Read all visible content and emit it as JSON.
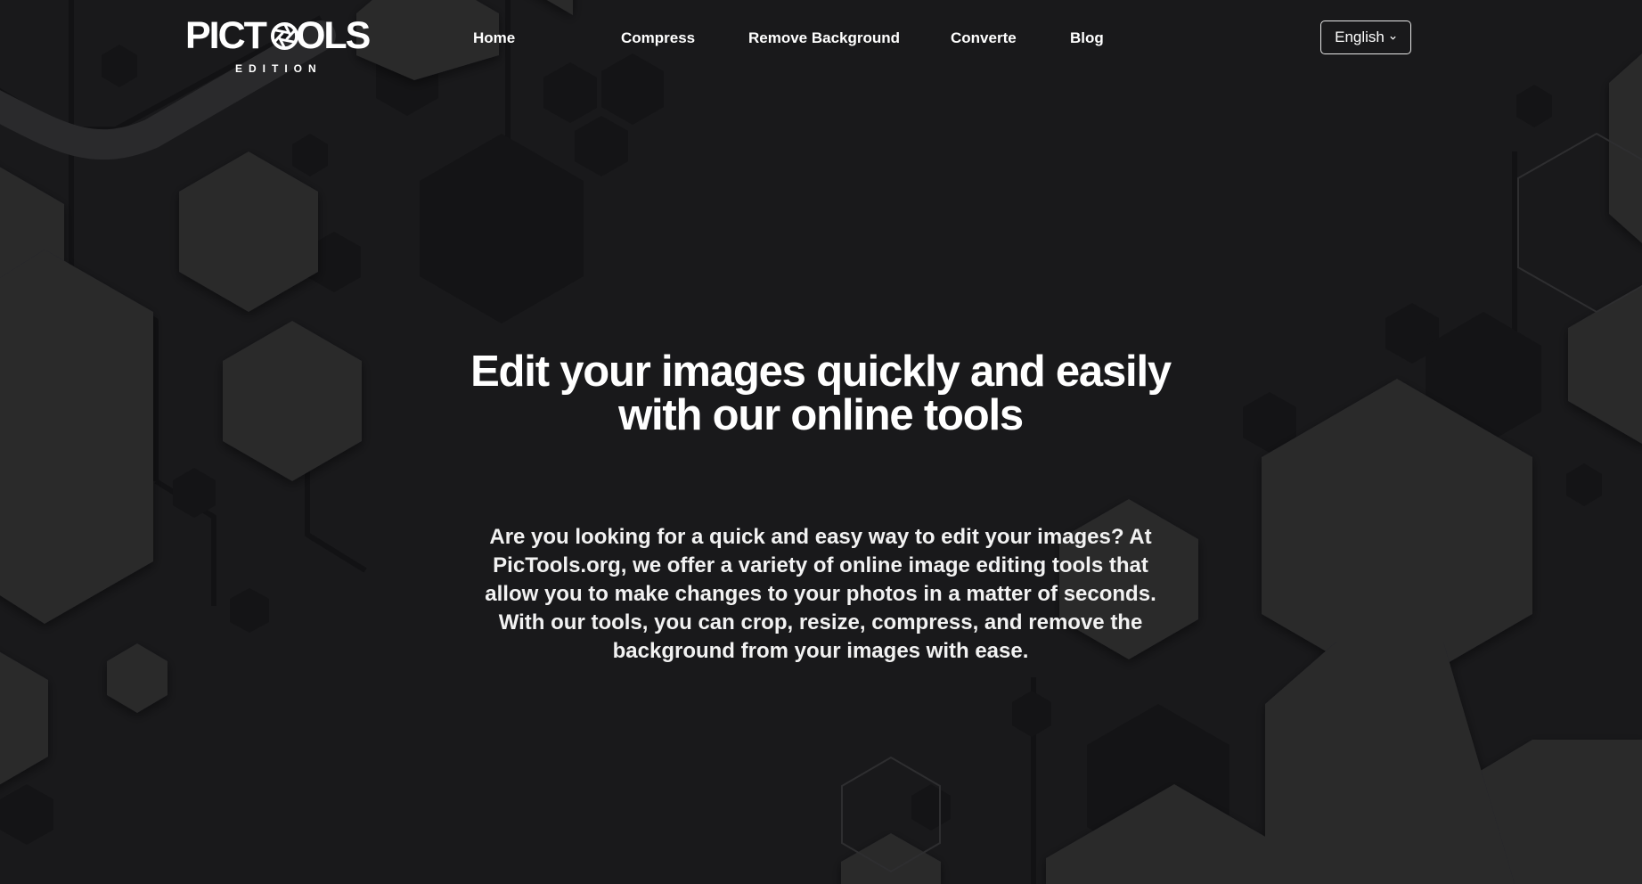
{
  "logo": {
    "main_text": "PICTOOLS",
    "sub_text": "EDITION"
  },
  "nav": {
    "items": [
      {
        "label": "Home"
      },
      {
        "label": "Compress"
      },
      {
        "label": "Remove Background"
      },
      {
        "label": "Converte"
      },
      {
        "label": "Blog"
      }
    ]
  },
  "language": {
    "selected": "English"
  },
  "hero": {
    "title_line1": "Edit your images quickly and easily",
    "title_line2": "with our online tools",
    "description": "Are you looking for a quick and easy way to edit your images? At PicTools.org, we offer a variety of online image editing tools that allow you to make changes to your photos in a matter of seconds. With our tools, you can crop, resize, compress, and remove the background from your images with ease."
  },
  "colors": {
    "background": "#19191b",
    "hexagon": "#28282a",
    "hexagon_dark": "#141416",
    "text": "#ffffff"
  },
  "icons": {
    "logo_shutter": "camera-shutter-icon",
    "language_chevron": "chevron-down-icon"
  }
}
